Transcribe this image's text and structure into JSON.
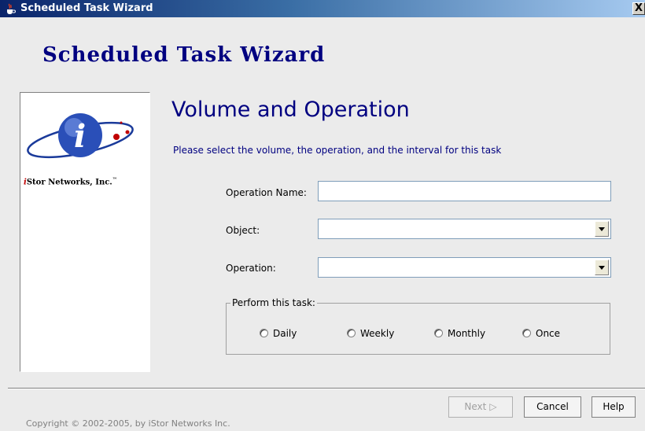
{
  "window": {
    "title": "Scheduled Task Wizard",
    "close_glyph": "X"
  },
  "header": {
    "title": "Scheduled Task Wizard"
  },
  "logo": {
    "text_i": "i",
    "text_rest": "Stor Networks, Inc.",
    "tm": "™"
  },
  "page": {
    "section_title": "Volume and Operation",
    "instructions": "Please select the volume, the operation, and the interval for this task"
  },
  "form": {
    "operation_name_label": "Operation Name:",
    "operation_name_value": "",
    "object_label": "Object:",
    "object_value": "",
    "operation_label": "Operation:",
    "operation_value": ""
  },
  "schedule": {
    "legend": "Perform this task:",
    "options": [
      "Daily",
      "Weekly",
      "Monthly",
      "Once"
    ]
  },
  "footer": {
    "copyright": "Copyright © 2002-2005, by iStor Networks Inc.",
    "next_label": "Next",
    "next_arrow": "▷",
    "cancel_label": "Cancel",
    "help_label": "Help"
  },
  "colors": {
    "accent": "#000080",
    "logo_red": "#c00000",
    "logo_blue": "#1a3a9a"
  }
}
